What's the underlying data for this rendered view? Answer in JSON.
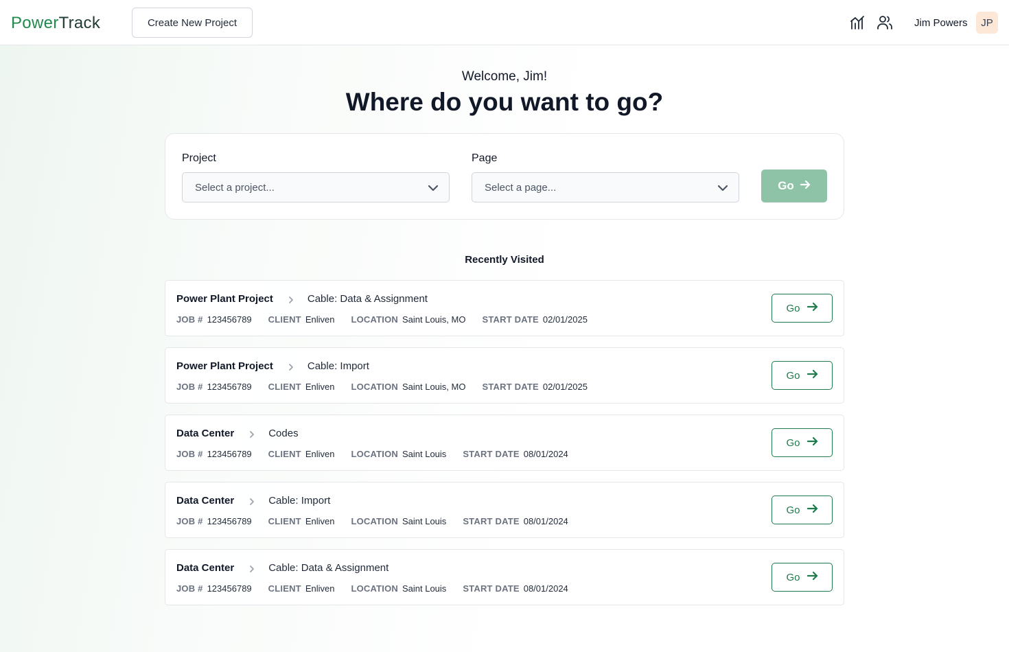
{
  "header": {
    "logo_part1": "Power",
    "logo_part2": "Track",
    "create_label": "Create New Project",
    "user_name": "Jim Powers",
    "user_initials": "JP",
    "icons": [
      "analytics-icon",
      "users-icon"
    ]
  },
  "hero": {
    "welcome": "Welcome, Jim!",
    "headline": "Where do you want to go?"
  },
  "selector": {
    "project_label": "Project",
    "project_placeholder": "Select a project...",
    "page_label": "Page",
    "page_placeholder": "Select a page...",
    "go_label": "Go"
  },
  "recent": {
    "title": "Recently Visited",
    "go_label": "Go",
    "labels": {
      "job": "JOB #",
      "client": "CLIENT",
      "location": "LOCATION",
      "start": "START DATE"
    },
    "items": [
      {
        "project": "Power Plant Project",
        "page": "Cable: Data & Assignment",
        "job": "123456789",
        "client": "Enliven",
        "location": "Saint Louis, MO",
        "start": "02/01/2025"
      },
      {
        "project": "Power Plant Project",
        "page": "Cable: Import",
        "job": "123456789",
        "client": "Enliven",
        "location": "Saint Louis, MO",
        "start": "02/01/2025"
      },
      {
        "project": "Data Center",
        "page": "Codes",
        "job": "123456789",
        "client": "Enliven",
        "location": "Saint Louis",
        "start": "08/01/2024"
      },
      {
        "project": "Data Center",
        "page": "Cable: Import",
        "job": "123456789",
        "client": "Enliven",
        "location": "Saint Louis",
        "start": "08/01/2024"
      },
      {
        "project": "Data Center",
        "page": "Cable: Data & Assignment",
        "job": "123456789",
        "client": "Enliven",
        "location": "Saint Louis",
        "start": "08/01/2024"
      }
    ]
  },
  "colors": {
    "brand_green": "#1f8a4c",
    "brand_dark": "#1f3b34",
    "go_disabled": "#8fc3a8",
    "go_outline": "#1f7a4d",
    "avatar_bg": "#fde7d6"
  }
}
